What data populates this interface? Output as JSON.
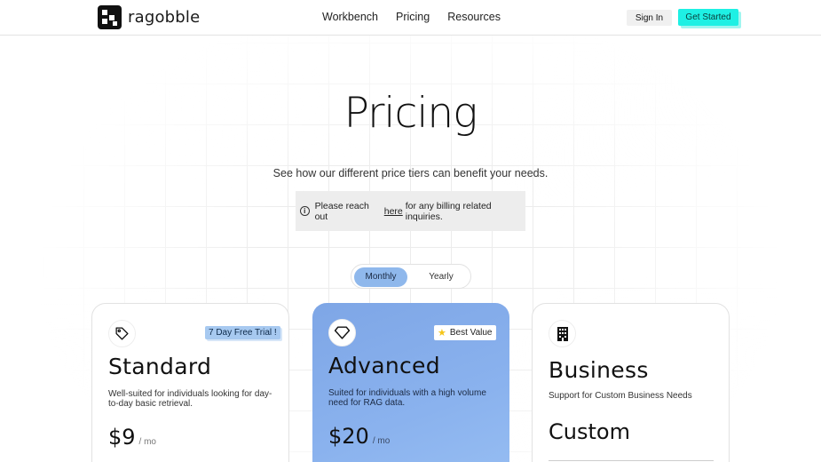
{
  "brand": {
    "name": "ragobble",
    "logo": "ragobble-logo-icon"
  },
  "nav": {
    "links": [
      "Workbench",
      "Pricing",
      "Resources"
    ],
    "sign_in": "Sign In",
    "get_started": "Get Started"
  },
  "hero": {
    "title": "Pricing",
    "subtitle": "See how our different price tiers can benefit your needs.",
    "notice": {
      "before": "Please reach out",
      "link": "here",
      "after": "for any billing related inquiries.",
      "icon": "info-icon"
    }
  },
  "billing_toggle": {
    "options": [
      "Monthly",
      "Yearly"
    ],
    "selected": "Monthly"
  },
  "plans": [
    {
      "name": "Standard",
      "icon": "tag-icon",
      "badge": "7 Day Free Trial !",
      "description": "Well-suited for individuals looking for day-to-day basic retrieval.",
      "price": "$9",
      "period": "/ mo"
    },
    {
      "name": "Advanced",
      "icon": "diamond-icon",
      "badge": "Best Value",
      "badge_icon": "star-icon",
      "description": "Suited for individuals with a high volume need for RAG data.",
      "price": "$20",
      "period": "/ mo"
    },
    {
      "name": "Business",
      "icon": "building-icon",
      "description": "Support for Custom Business Needs",
      "price": "Custom"
    }
  ],
  "colors": {
    "accent": "#1ef0e4",
    "advanced_card": "#8ab2ee",
    "toggle_active": "#8fb8ec"
  }
}
